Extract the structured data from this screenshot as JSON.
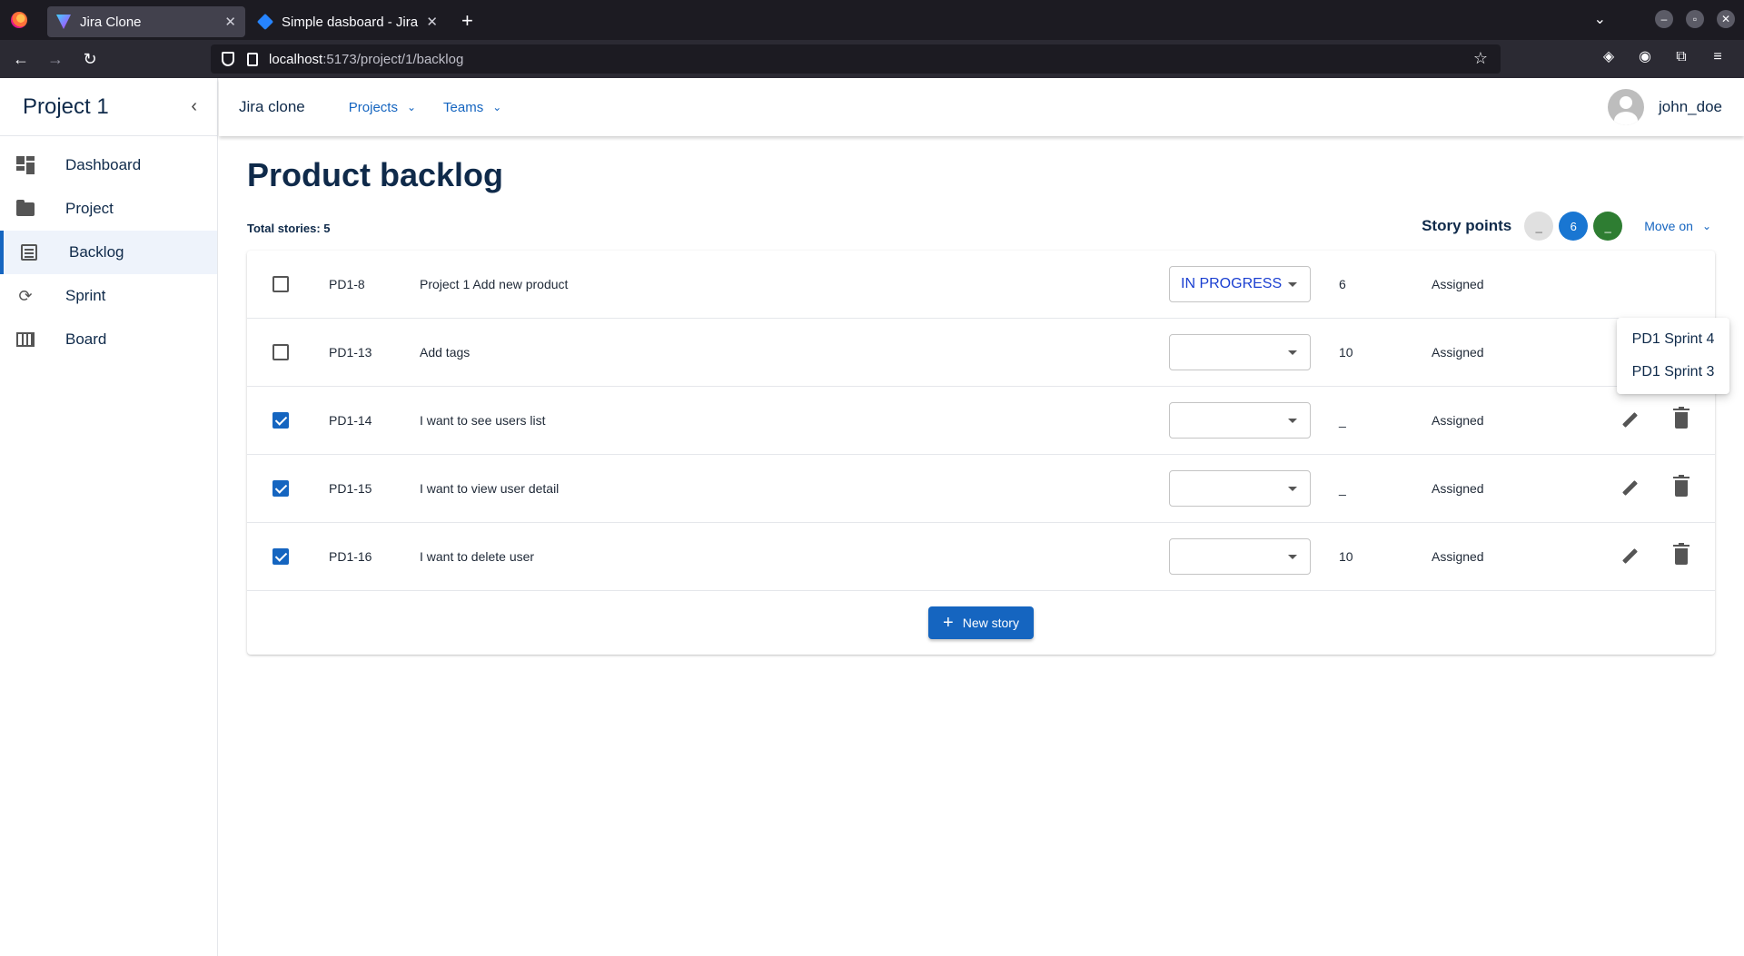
{
  "browser": {
    "tabs": [
      {
        "title": "Jira Clone",
        "active": true
      },
      {
        "title": "Simple dasboard - Jira",
        "active": false
      }
    ],
    "url_host": "localhost",
    "url_path": ":5173/project/1/backlog"
  },
  "sidebar": {
    "title": "Project 1",
    "items": [
      {
        "label": "Dashboard",
        "icon": "dashboard-icon"
      },
      {
        "label": "Project",
        "icon": "folder-icon"
      },
      {
        "label": "Backlog",
        "icon": "list-icon",
        "active": true
      },
      {
        "label": "Sprint",
        "icon": "sync-icon"
      },
      {
        "label": "Board",
        "icon": "board-icon"
      }
    ]
  },
  "topbar": {
    "brand": "Jira clone",
    "nav": [
      {
        "label": "Projects"
      },
      {
        "label": "Teams"
      }
    ],
    "username": "john_doe"
  },
  "main": {
    "title": "Product backlog",
    "total_label": "Total stories: 5",
    "story_points_label": "Story points",
    "badges": [
      {
        "value": "_",
        "color": "#e0e0e0",
        "text_color": "#666666"
      },
      {
        "value": "6",
        "color": "#1976d2",
        "text_color": "#ffffff"
      },
      {
        "value": "_",
        "color": "#2e7d32",
        "text_color": "#ffffff"
      }
    ],
    "move_on_label": "Move on",
    "new_story_label": "New story"
  },
  "stories": [
    {
      "id": "PD1-8",
      "title": "Project 1 Add new product",
      "status": "IN PROGRESS",
      "points": "6",
      "assignee": "Assigned",
      "checked": false
    },
    {
      "id": "PD1-13",
      "title": "Add tags",
      "status": "",
      "points": "10",
      "assignee": "Assigned",
      "checked": false
    },
    {
      "id": "PD1-14",
      "title": "I want to see users list",
      "status": "",
      "points": "_",
      "assignee": "Assigned",
      "checked": true
    },
    {
      "id": "PD1-15",
      "title": "I want to view user detail",
      "status": "",
      "points": "_",
      "assignee": "Assigned",
      "checked": true
    },
    {
      "id": "PD1-16",
      "title": "I want to delete user",
      "status": "",
      "points": "10",
      "assignee": "Assigned",
      "checked": true
    }
  ],
  "move_menu": {
    "items": [
      "PD1 Sprint 4",
      "PD1 Sprint 3"
    ]
  }
}
